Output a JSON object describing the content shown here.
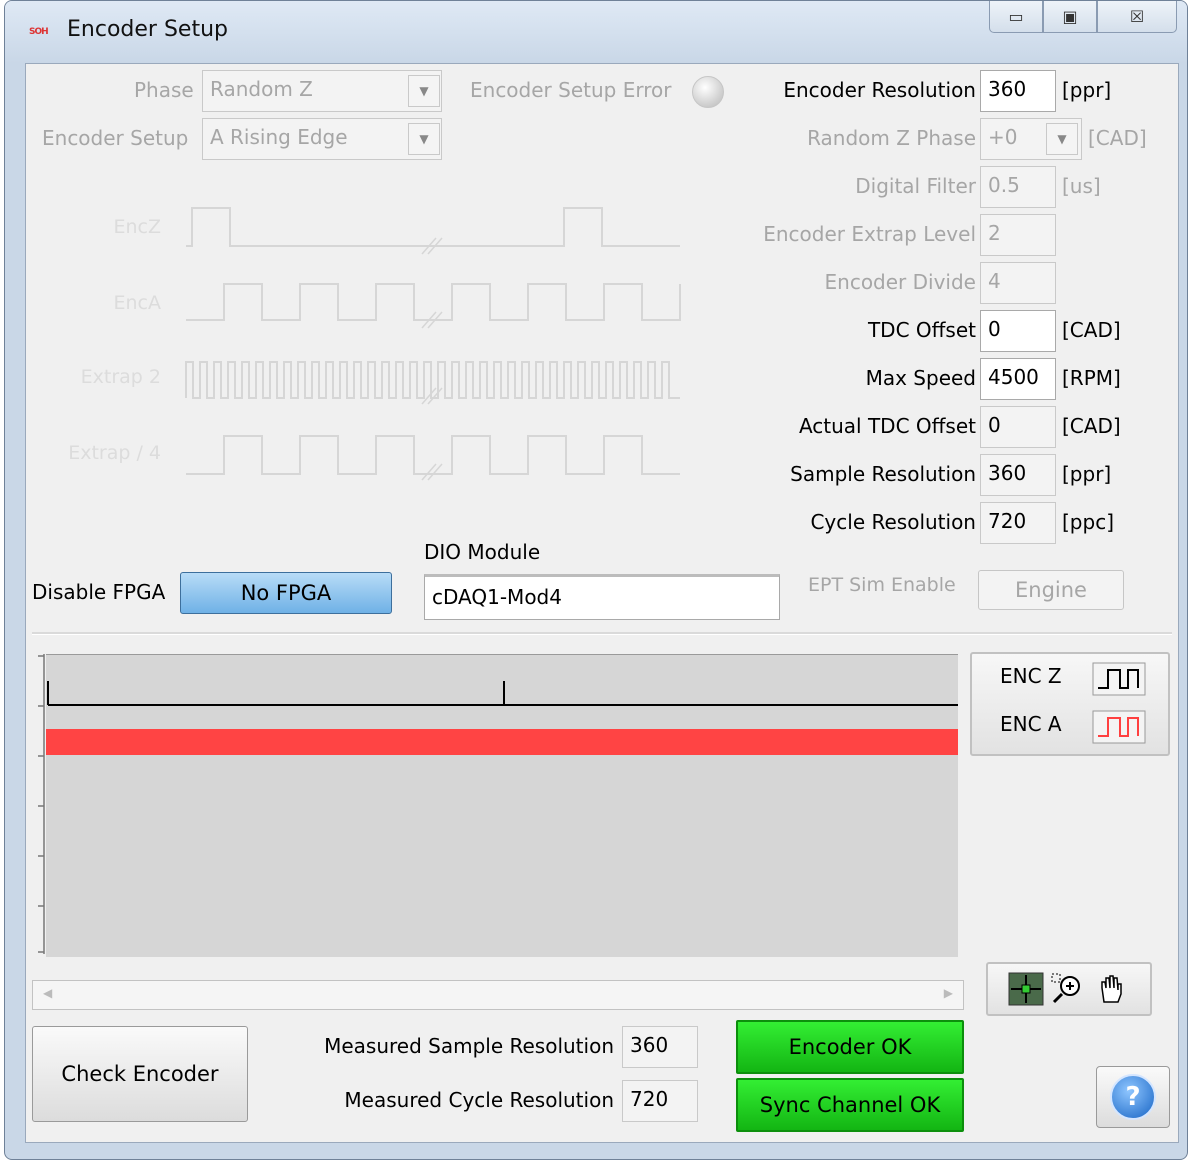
{
  "window": {
    "logo_text": "SOH",
    "title": "Encoder Setup",
    "minimize_glyph": "▭",
    "maximize_glyph": "▣",
    "close_glyph": "☒"
  },
  "top_left": {
    "phase_label": "Phase",
    "phase_value": "Random Z",
    "encoder_setup_label": "Encoder Setup",
    "encoder_setup_value": "A Rising Edge",
    "error_label": "Encoder Setup Error",
    "dropdown_glyph": "▼"
  },
  "waveforms": {
    "labels": [
      "EncZ",
      "EncA",
      "Extrap 2",
      "Extrap / 4"
    ]
  },
  "settings": [
    {
      "label": "Encoder Resolution",
      "value": "360",
      "unit": "[ppr]",
      "enabled": true,
      "bold": true
    },
    {
      "label": "Random Z Phase",
      "value": "+0",
      "unit": "[CAD]",
      "enabled": false,
      "dropdown": true
    },
    {
      "label": "Digital Filter",
      "value": "0.5",
      "unit": "[us]",
      "enabled": false
    },
    {
      "label": "Encoder Extrap Level",
      "value": "2",
      "unit": "",
      "enabled": false
    },
    {
      "label": "Encoder Divide",
      "value": "4",
      "unit": "",
      "enabled": false
    },
    {
      "label": "TDC Offset",
      "value": "0",
      "unit": "[CAD]",
      "enabled": true
    },
    {
      "label": "Max Speed",
      "value": "4500",
      "unit": "[RPM]",
      "enabled": true
    },
    {
      "label": "Actual TDC Offset",
      "value": "0",
      "unit": "[CAD]",
      "enabled": true,
      "readonly": true
    },
    {
      "label": "Sample Resolution",
      "value": "360",
      "unit": "[ppr]",
      "enabled": true,
      "readonly": true
    },
    {
      "label": "Cycle Resolution",
      "value": "720",
      "unit": "[ppc]",
      "enabled": true,
      "readonly": true
    }
  ],
  "fpga": {
    "disable_label": "Disable FPGA",
    "button_label": "No FPGA",
    "dio_label": "DIO Module",
    "dio_value": "cDAQ1-Mod4",
    "ept_label": "EPT Sim Enable",
    "engine_button": "Engine"
  },
  "graph": {
    "legend": [
      {
        "name": "ENC Z",
        "color": "#000000"
      },
      {
        "name": "ENC A",
        "color": "#ff4040"
      }
    ],
    "enc_a_color": "#ff4444",
    "scroll_left": "◀",
    "scroll_right": "▶"
  },
  "bottom": {
    "check_button": "Check Encoder",
    "measured_sample_label": "Measured Sample Resolution",
    "measured_sample_value": "360",
    "measured_cycle_label": "Measured Cycle Resolution",
    "measured_cycle_value": "720",
    "encoder_status": "Encoder OK",
    "sync_status": "Sync Channel OK",
    "help_glyph": "?"
  }
}
